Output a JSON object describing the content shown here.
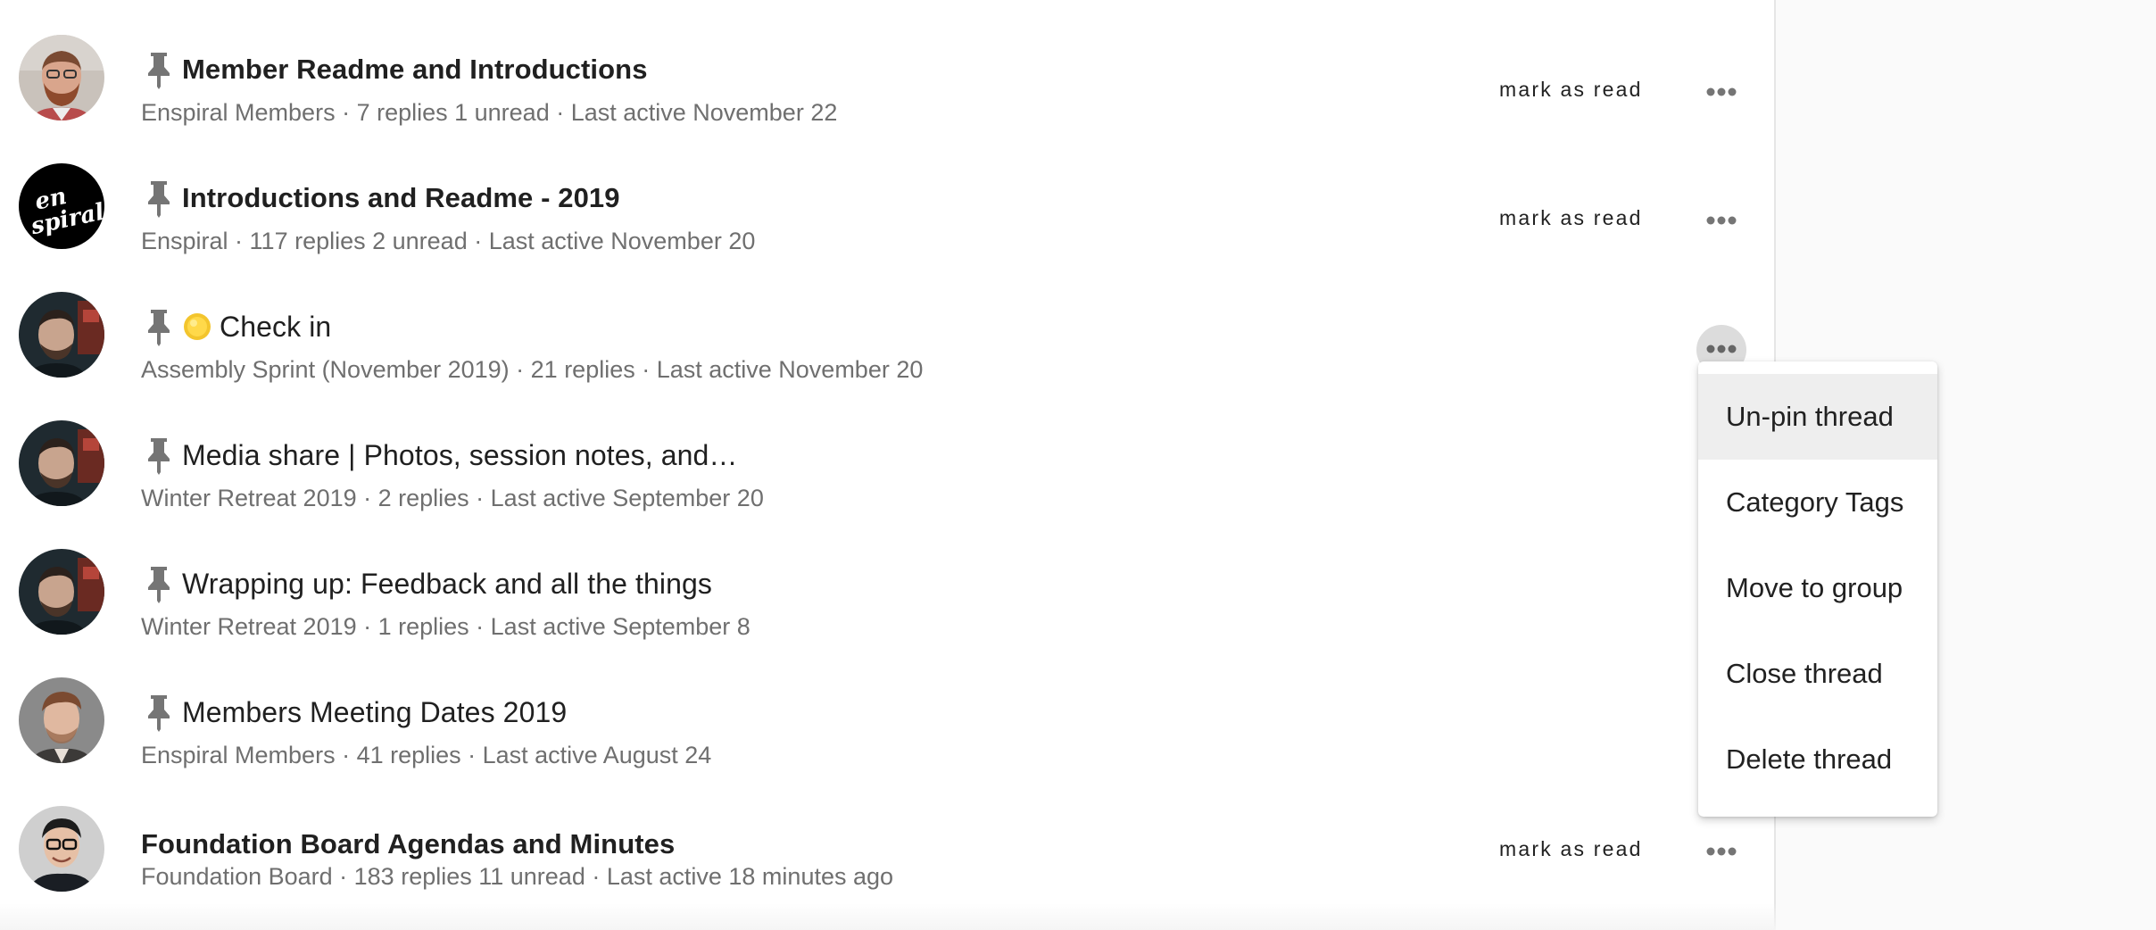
{
  "threads": [
    {
      "title": "Member Readme and Introductions",
      "meta": "Enspiral Members · 7 replies 1 unread · Last active November 22",
      "mark_as_read": "mark as read",
      "pinned": true,
      "unread": true
    },
    {
      "title": "Introductions and Readme - 2019",
      "meta": "Enspiral · 117 replies 2 unread · Last active November 20",
      "mark_as_read": "mark as read",
      "pinned": true,
      "unread": true
    },
    {
      "title": "Check in",
      "meta": "Assembly Sprint (November 2019) · 21 replies  · Last active November 20",
      "pinned": true,
      "unread": false,
      "emoji": "sun-icon"
    },
    {
      "title": "Media share | Photos, session notes, and…",
      "meta": "Winter Retreat 2019 · 2 replies  · Last active September 20",
      "pinned": true,
      "unread": false
    },
    {
      "title": "Wrapping up: Feedback and all the things",
      "meta": "Winter Retreat 2019 · 1 replies  · Last active September 8",
      "pinned": true,
      "unread": false
    },
    {
      "title": "Members Meeting Dates 2019",
      "meta": "Enspiral Members · 41 replies  · Last active August 24",
      "pinned": true,
      "unread": false
    },
    {
      "title": "Foundation Board Agendas and Minutes",
      "meta": "Foundation Board · 183 replies 11 unread · Last active 18 minutes ago",
      "mark_as_read": "mark as read",
      "pinned": false,
      "unread": true
    }
  ],
  "avatar_logo_text": [
    "en",
    "spiral"
  ],
  "menu": {
    "items": [
      "Un-pin thread",
      "Category Tags",
      "Move to group",
      "Close thread",
      "Delete thread"
    ],
    "highlighted_index": 0
  },
  "colors": {
    "pin": "#757575",
    "dots": "#757575",
    "meta_text": "#6f6f6f",
    "menu_highlight": "#eeeeee"
  }
}
